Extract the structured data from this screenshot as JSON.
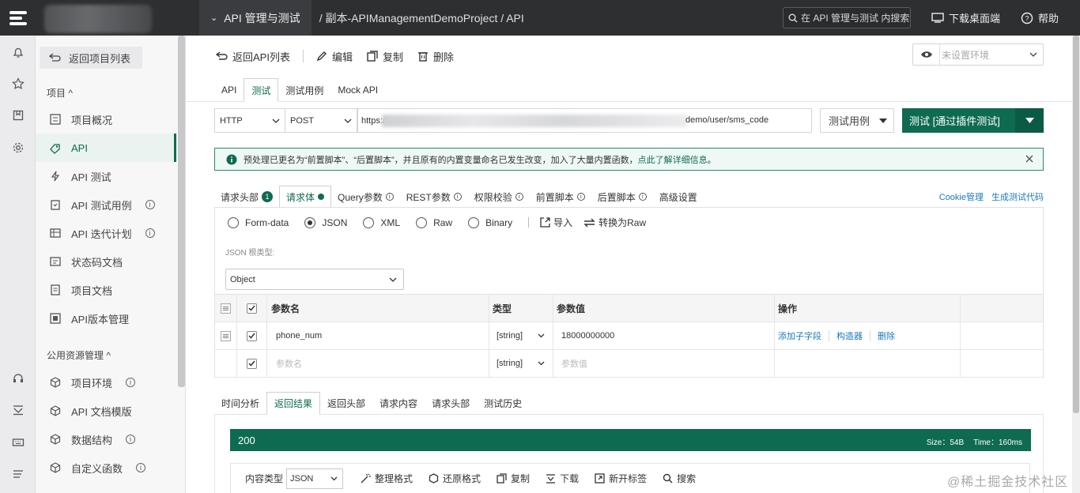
{
  "topbar": {
    "breadcrumb_main": "API 管理与测试",
    "breadcrumb_rest": "/ 副本-APIManagementDemoProject / API",
    "search_placeholder": "在 API 管理与测试 内搜索",
    "download_label": "下载桌面端",
    "help_label": "帮助"
  },
  "sidebar": {
    "back_label": "返回项目列表",
    "section_project": "项目 ^",
    "section_public": "公用资源管理 ^",
    "items": [
      {
        "label": "项目概况",
        "icon": "overview-icon"
      },
      {
        "label": "API",
        "icon": "api-icon"
      },
      {
        "label": "API 测试",
        "icon": "lightning-icon"
      },
      {
        "label": "API 测试用例",
        "icon": "clipboard-icon",
        "info": "i"
      },
      {
        "label": "API 迭代计划",
        "icon": "table-icon",
        "info": "i"
      },
      {
        "label": "状态码文档",
        "icon": "doc-icon"
      },
      {
        "label": "项目文档",
        "icon": "file-icon"
      },
      {
        "label": "API版本管理",
        "icon": "version-icon"
      }
    ],
    "public_items": [
      {
        "label": "项目环境",
        "icon": "cube-icon",
        "info": "i"
      },
      {
        "label": "API 文档模版",
        "icon": "cube-icon"
      },
      {
        "label": "数据结构",
        "icon": "cube-icon",
        "info": "i"
      },
      {
        "label": "自定义函数",
        "icon": "cube-icon",
        "info": "i"
      }
    ]
  },
  "toolbar": {
    "back_api_list": "返回API列表",
    "edit": "编辑",
    "copy": "复制",
    "delete": "删除",
    "env_placeholder": "未设置环境"
  },
  "api_tabs": [
    "API",
    "测试",
    "测试用例",
    "Mock API"
  ],
  "request": {
    "protocol": "HTTP",
    "method": "POST",
    "url_prefix": "https:/",
    "url_suffix": "demo/user/sms_code",
    "case_select": "测试用例",
    "test_button": "测试 [通过插件测试]"
  },
  "notice": {
    "text": "预处理已更名为“前置脚本”、“后置脚本”，并且原有的内置变量命名已发生改变，加入了大量内置函数，",
    "link": "点此了解详细信息",
    "end": "。"
  },
  "req_tabs": {
    "headers": "请求头部",
    "headers_count": "1",
    "body": "请求体",
    "query": "Query参数",
    "rest": "REST参数",
    "auth": "权限校验",
    "pre": "前置脚本",
    "post": "后置脚本",
    "advanced": "高级设置",
    "cookie": "Cookie管理",
    "gen_code": "生成测试代码"
  },
  "body": {
    "options": [
      "Form-data",
      "JSON",
      "XML",
      "Raw",
      "Binary"
    ],
    "selected": "JSON",
    "import": "导入",
    "convert": "转换为Raw",
    "root_label": "JSON 根类型:",
    "root_value": "Object"
  },
  "params_table": {
    "headers": {
      "name": "参数名",
      "type": "类型",
      "value": "参数值",
      "ops": "操作"
    },
    "rows": [
      {
        "name": "phone_num",
        "type": "[string]",
        "value": "18000000000",
        "op_add": "添加子字段",
        "op_build": "构造器",
        "op_del": "删除"
      }
    ],
    "empty_row": {
      "name_ph": "参数名",
      "type": "[string]",
      "value_ph": "参数值"
    }
  },
  "resp_tabs": [
    "时间分析",
    "返回结果",
    "返回头部",
    "请求内容",
    "请求头部",
    "测试历史"
  ],
  "response": {
    "status": "200",
    "size": "Size：54B",
    "time": "Time：160ms",
    "content_type_label": "内容类型",
    "content_type": "JSON",
    "format": "整理格式",
    "restore": "还原格式",
    "copy": "复制",
    "download": "下载",
    "new_tab": "新开标签",
    "search": "搜索"
  },
  "watermark": "@稀土掘金技术社区",
  "colors": {
    "accent": "#0e6b52",
    "topbar": "#2e2f31",
    "link": "#1d79b8"
  }
}
